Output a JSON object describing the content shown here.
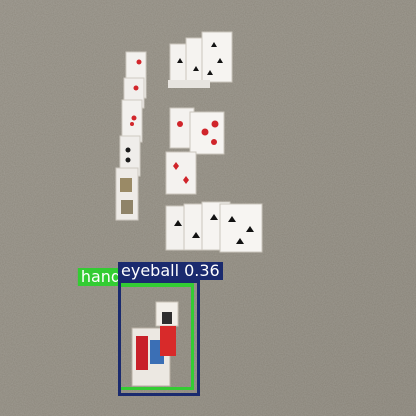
{
  "image": {
    "description": "Photo of playing cards laid out in columns on beige carpet with object-detection overlay boxes"
  },
  "detections": [
    {
      "name": "green",
      "text": "handlers 0.63",
      "color": "#33cc33"
    },
    {
      "name": "navy",
      "text": "eyeball 0.36",
      "color": "#1a2a6e"
    }
  ]
}
